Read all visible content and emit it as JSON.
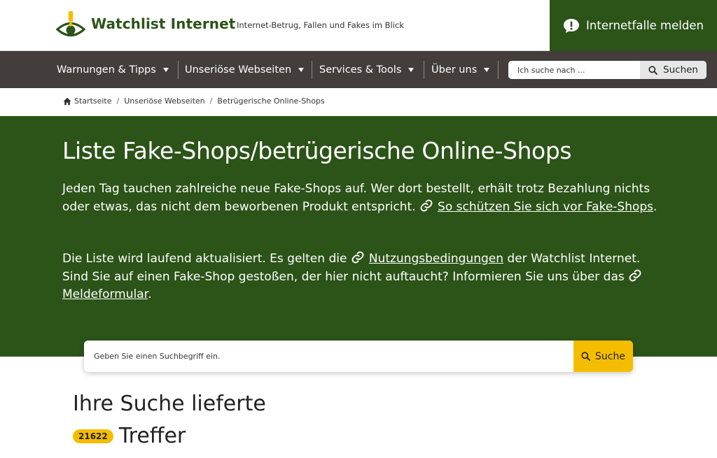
{
  "header": {
    "logo_text": "Watchlist Internet",
    "tagline": "Internet-Betrug, Fallen und Fakes im Blick",
    "report_button": "Internetfalle melden"
  },
  "nav": {
    "items": [
      {
        "label": "Warnungen & Tipps"
      },
      {
        "label": "Unseriöse Webseiten"
      },
      {
        "label": "Services & Tools"
      },
      {
        "label": "Über uns"
      }
    ],
    "search_placeholder": "Ich suche nach ...",
    "search_button": "Suchen"
  },
  "breadcrumb": {
    "items": [
      "Startseite",
      "Unseriöse Webseiten",
      "Betrügerische Online-Shops"
    ]
  },
  "hero": {
    "title": "Liste Fake-Shops/betrügerische Online-Shops",
    "p1_text": "Jeden Tag tauchen zahlreiche neue Fake-Shops auf. Wer dort bestellt, erhält trotz Bezahlung nichts oder etwas, das nicht dem beworbenen Produkt entspricht.",
    "p1_link": "So schützen Sie sich vor Fake-Shops",
    "p1_end": ".",
    "p2_text_a": "Die Liste wird laufend aktualisiert. Es gelten die",
    "p2_link1": "Nutzungsbedingungen",
    "p2_text_b": "der Watchlist Internet. Sind Sie auf einen Fake-Shop gestoßen, der hier nicht auftaucht? Informieren Sie uns über das",
    "p2_link2": "Meldeformular",
    "p2_end": "."
  },
  "search": {
    "placeholder": "Geben Sie einen Suchbegriff ein.",
    "button": "Suche"
  },
  "results": {
    "title": "Ihre Suche lieferte",
    "count": "21622",
    "word": "Treffer"
  },
  "colors": {
    "brand_green": "#2c5318",
    "nav_bg": "#433e3c",
    "accent_yellow": "#f5bd00"
  }
}
